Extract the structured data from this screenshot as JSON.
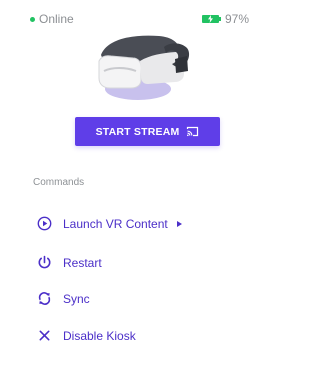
{
  "status": {
    "online_label": "Online",
    "battery_label": "97%",
    "battery_level": 0.97,
    "online_color": "#21c262",
    "battery_color": "#21c262"
  },
  "device_image": {
    "icon": "vr-headset-icon"
  },
  "stream_button": {
    "label": "START STREAM",
    "icon": "cast-icon",
    "color": "#5f3ee8"
  },
  "commands": {
    "title": "Commands",
    "items": [
      {
        "label": "Launch VR Content",
        "icon": "play-circle-icon",
        "has_submenu": true,
        "submenu_icon": "caret-right-icon"
      },
      {
        "label": "Restart",
        "icon": "power-icon"
      },
      {
        "label": "Sync",
        "icon": "sync-icon"
      },
      {
        "label": "Disable Kiosk",
        "icon": "close-icon"
      }
    ]
  },
  "accent_color": "#4b2fc8"
}
